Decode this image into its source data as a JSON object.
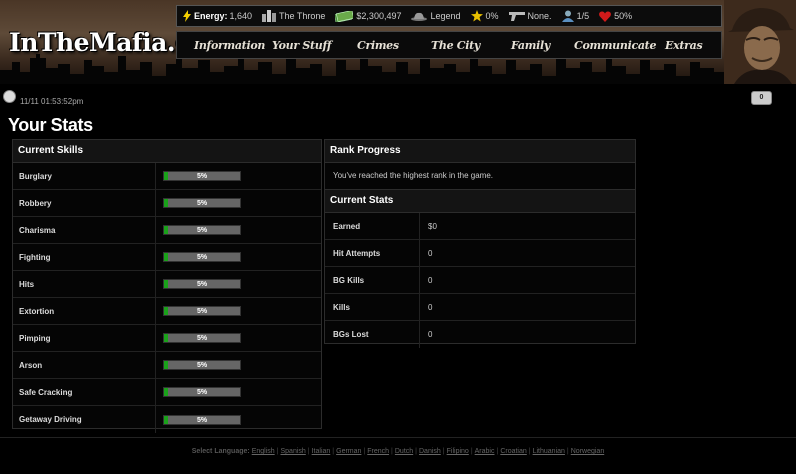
{
  "header": {
    "logo": "InTheMafia.com",
    "stats": {
      "energy_label": "Energy:",
      "energy_value": "1,640",
      "location": "The Throne",
      "cash": "$2,300,497",
      "rank": "Legend",
      "health_pct": "0%",
      "weapon": "None.",
      "bodyguards": "1/5",
      "health": "50%"
    },
    "nav": [
      "Information",
      "Your Stuff",
      "Crimes",
      "The City",
      "Family",
      "Communicate",
      "Extras"
    ]
  },
  "subheader": {
    "timestamp": "11/11 01:53:52pm",
    "messages": "0"
  },
  "page_title": "Your Stats",
  "skills": {
    "title": "Current Skills",
    "items": [
      {
        "name": "Burglary",
        "pct": "5%",
        "level": 0.05
      },
      {
        "name": "Robbery",
        "pct": "5%",
        "level": 0.05
      },
      {
        "name": "Charisma",
        "pct": "5%",
        "level": 0.05
      },
      {
        "name": "Fighting",
        "pct": "5%",
        "level": 0.05
      },
      {
        "name": "Hits",
        "pct": "5%",
        "level": 0.05
      },
      {
        "name": "Extortion",
        "pct": "5%",
        "level": 0.05
      },
      {
        "name": "Pimping",
        "pct": "5%",
        "level": 0.05
      },
      {
        "name": "Arson",
        "pct": "5%",
        "level": 0.05
      },
      {
        "name": "Safe Cracking",
        "pct": "5%",
        "level": 0.05
      },
      {
        "name": "Getaway Driving",
        "pct": "5%",
        "level": 0.05
      }
    ]
  },
  "rank_progress": {
    "title": "Rank Progress",
    "text": "You've reached the highest rank in the game."
  },
  "current_stats": {
    "title": "Current Stats",
    "rows": [
      {
        "label": "Earned",
        "value": "$0"
      },
      {
        "label": "Hit Attempts",
        "value": "0"
      },
      {
        "label": "BG Kills",
        "value": "0"
      },
      {
        "label": "Kills",
        "value": "0"
      },
      {
        "label": "BGs Lost",
        "value": "0"
      }
    ]
  },
  "footer": {
    "label": "Select Language:",
    "languages": [
      "English",
      "Spanish",
      "Italian",
      "German",
      "French",
      "Dutch",
      "Danish",
      "Filipino",
      "Arabic",
      "Croatian",
      "Lithuanian",
      "Norwegian"
    ]
  },
  "colors": {
    "progress_fill": "#1aa21a",
    "header_brown": "#4a3626",
    "health_heart": "#d11a1a"
  }
}
